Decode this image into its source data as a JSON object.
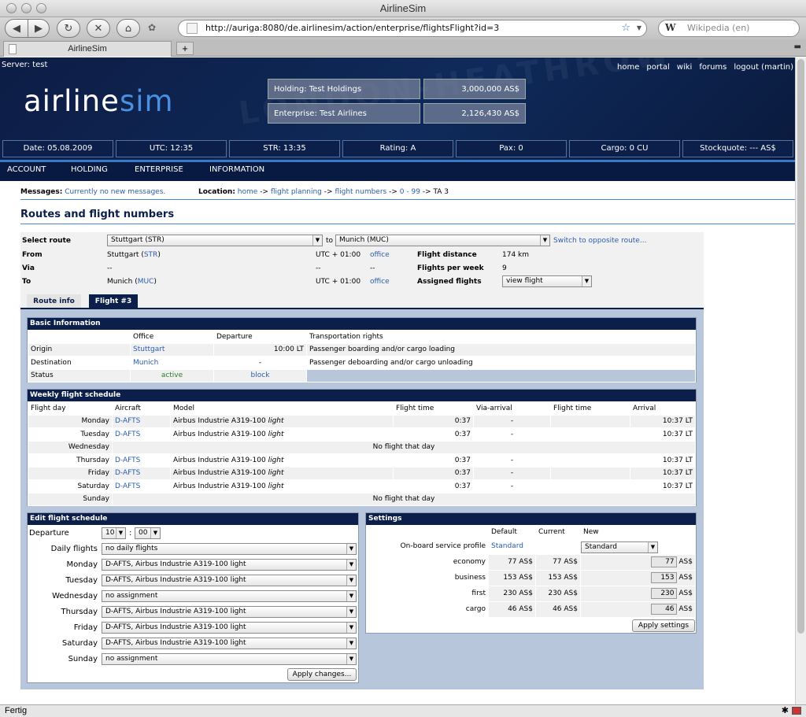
{
  "browser": {
    "window_title": "AirlineSim",
    "url": "http://auriga:8080/de.airlinesim/action/enterprise/flightsFlight?id=3",
    "search_placeholder": "Wikipedia (en)",
    "search_engine_glyph": "W",
    "tab_label": "AirlineSim",
    "status_text": "Fertig"
  },
  "header": {
    "server": "Server: test",
    "links": [
      "home",
      "portal",
      "wiki",
      "forums",
      "logout (martin)"
    ],
    "logo_a": "airline",
    "logo_b": "sim",
    "holding_label": "Holding: Test Holdings",
    "holding_value": "3,000,000 AS$",
    "enterprise_label": "Enterprise: Test Airlines",
    "enterprise_value": "2,126,430 AS$",
    "infobar": [
      "Date: 05.08.2009",
      "UTC: 12:35",
      "STR: 13:35",
      "Rating: A",
      "Pax: 0",
      "Cargo: 0 CU",
      "Stockquote: --- AS$"
    ],
    "deco_text": "LONDON-HEATHROW TOKYO"
  },
  "menu": [
    "ACCOUNT",
    "HOLDING",
    "ENTERPRISE",
    "INFORMATION"
  ],
  "messages": {
    "label": "Messages:",
    "text": "Currently no new messages."
  },
  "location": {
    "label": "Location:",
    "crumbs": [
      "home",
      "flight planning",
      "flight numbers",
      "0 - 99"
    ],
    "sep": "->",
    "current": "TA 3"
  },
  "page_title": "Routes and flight numbers",
  "route": {
    "select_label": "Select route",
    "from_select": "Stuttgart (STR)",
    "to_word": "to",
    "to_select": "Munich (MUC)",
    "switch_link": "Switch to opposite route...",
    "from_label": "From",
    "from_city": "Stuttgart",
    "from_code": "STR",
    "from_utc": "UTC + 01:00",
    "from_office": "office",
    "via_label": "Via",
    "via_city": "--",
    "via_utc": "--",
    "via_office": "--",
    "to_label": "To",
    "to_city": "Munich",
    "to_code": "MUC",
    "to_utc": "UTC + 01:00",
    "to_office": "office",
    "distance_label": "Flight distance",
    "distance_value": "174 km",
    "fpw_label": "Flights per week",
    "fpw_value": "9",
    "assigned_label": "Assigned flights",
    "assigned_select": "view flight"
  },
  "tabs": [
    "Route info",
    "Flight #3"
  ],
  "basic": {
    "title": "Basic Information",
    "headers": [
      "",
      "Office",
      "Departure",
      "Transportation rights"
    ],
    "origin_label": "Origin",
    "origin_office": "Stuttgart",
    "origin_dep": "10:00 LT",
    "origin_rights": "Passenger boarding and/or cargo loading",
    "dest_label": "Destination",
    "dest_office": "Munich",
    "dest_dep": "-",
    "dest_rights": "Passenger deboarding and/or cargo unloading",
    "status_label": "Status",
    "status_value": "active",
    "status_action": "block"
  },
  "weekly": {
    "title": "Weekly flight schedule",
    "headers": [
      "Flight day",
      "Aircraft",
      "Model",
      "Flight time",
      "Via-arrival",
      "Flight time",
      "Arrival"
    ],
    "model_base": "Airbus Industrie A319-100",
    "model_suffix": "light",
    "no_flight": "No flight that day",
    "rows": [
      {
        "day": "Monday",
        "aircraft": "D-AFTS",
        "time": "0:37",
        "via": "-",
        "arr": "10:37 LT"
      },
      {
        "day": "Tuesday",
        "aircraft": "D-AFTS",
        "time": "0:37",
        "via": "-",
        "arr": "10:37 LT"
      },
      {
        "day": "Wednesday",
        "none": true
      },
      {
        "day": "Thursday",
        "aircraft": "D-AFTS",
        "time": "0:37",
        "via": "-",
        "arr": "10:37 LT"
      },
      {
        "day": "Friday",
        "aircraft": "D-AFTS",
        "time": "0:37",
        "via": "-",
        "arr": "10:37 LT"
      },
      {
        "day": "Saturday",
        "aircraft": "D-AFTS",
        "time": "0:37",
        "via": "-",
        "arr": "10:37 LT"
      },
      {
        "day": "Sunday",
        "none": true
      }
    ]
  },
  "edit": {
    "title": "Edit flight schedule",
    "departure_label": "Departure",
    "hour": "10",
    "colon": ":",
    "minute": "00",
    "rows": [
      {
        "label": "Daily flights",
        "value": "no daily flights"
      },
      {
        "label": "Monday",
        "value": "D-AFTS, Airbus Industrie A319-100 light"
      },
      {
        "label": "Tuesday",
        "value": "D-AFTS, Airbus Industrie A319-100 light"
      },
      {
        "label": "Wednesday",
        "value": "no assignment"
      },
      {
        "label": "Thursday",
        "value": "D-AFTS, Airbus Industrie A319-100 light"
      },
      {
        "label": "Friday",
        "value": "D-AFTS, Airbus Industrie A319-100 light"
      },
      {
        "label": "Saturday",
        "value": "D-AFTS, Airbus Industrie A319-100 light"
      },
      {
        "label": "Sunday",
        "value": "no assignment"
      }
    ],
    "apply_label": "Apply changes..."
  },
  "settings": {
    "title": "Settings",
    "headers": [
      "",
      "Default",
      "Current",
      "New"
    ],
    "profile_label": "On-board service profile",
    "profile_default": "Standard",
    "profile_new": "Standard",
    "currency": "AS$",
    "rows": [
      {
        "label": "economy",
        "default": "77 AS$",
        "current": "77 AS$",
        "new": "77"
      },
      {
        "label": "business",
        "default": "153 AS$",
        "current": "153 AS$",
        "new": "153"
      },
      {
        "label": "first",
        "default": "230 AS$",
        "current": "230 AS$",
        "new": "230"
      },
      {
        "label": "cargo",
        "default": "46 AS$",
        "current": "46 AS$",
        "new": "46"
      }
    ],
    "apply_label": "Apply settings"
  }
}
